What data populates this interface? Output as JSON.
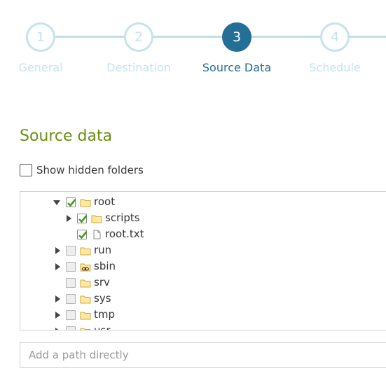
{
  "wizard": {
    "steps": [
      {
        "number": "1",
        "label": "General",
        "state": "inactive"
      },
      {
        "number": "2",
        "label": "Destination",
        "state": "inactive"
      },
      {
        "number": "3",
        "label": "Source Data",
        "state": "active"
      },
      {
        "number": "4",
        "label": "Schedule",
        "state": "inactive"
      }
    ]
  },
  "section": {
    "title": "Source data",
    "show_hidden_label": "Show hidden folders",
    "show_hidden_checked": false
  },
  "tree": {
    "items": [
      {
        "name": "root",
        "type": "folder",
        "checked": true,
        "expanded": true
      },
      {
        "name": "scripts",
        "type": "folder",
        "checked": true,
        "expanded": false
      },
      {
        "name": "root.txt",
        "type": "file",
        "checked": true
      },
      {
        "name": "run",
        "type": "folder",
        "checked": false,
        "expanded": false
      },
      {
        "name": "sbin",
        "type": "folder-link",
        "checked": false,
        "expanded": false
      },
      {
        "name": "srv",
        "type": "folder",
        "checked": false
      },
      {
        "name": "sys",
        "type": "folder",
        "checked": false,
        "expanded": false
      },
      {
        "name": "tmp",
        "type": "folder",
        "checked": false,
        "expanded": false
      },
      {
        "name": "usr",
        "type": "folder",
        "checked": false,
        "expanded": false
      }
    ]
  },
  "path_input": {
    "placeholder": "Add a path directly",
    "value": ""
  },
  "colors": {
    "accent": "#246f95",
    "inactive_step": "#c6e3ec",
    "section_title": "#6a8f11",
    "check": "#3f9c1f",
    "folder_fill": "#fde9a5",
    "folder_stroke": "#d1a92d"
  }
}
